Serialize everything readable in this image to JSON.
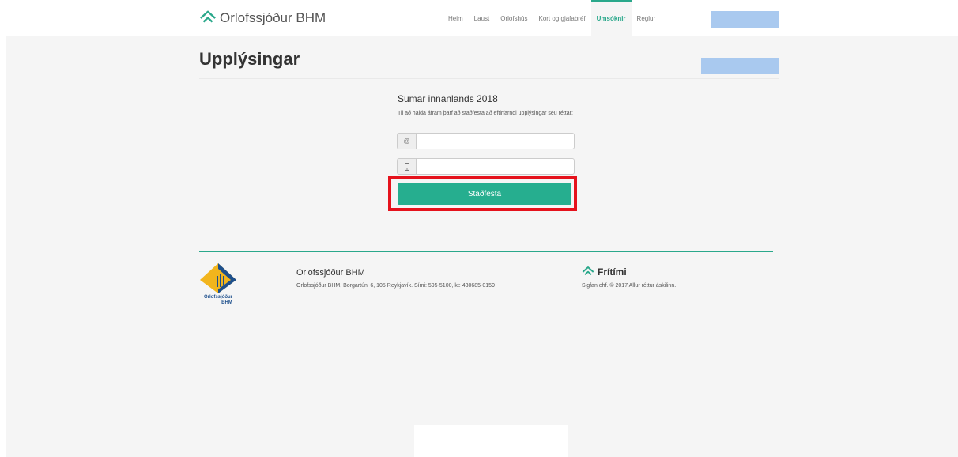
{
  "header": {
    "brand": "Orlofssjóður BHM",
    "nav": [
      "Heim",
      "Laust",
      "Orlofshús",
      "Kort og gjafabréf",
      "Umsóknir",
      "Reglur"
    ],
    "active_nav": "Umsóknir"
  },
  "page": {
    "title": "Upplýsingar"
  },
  "form": {
    "heading": "Sumar innanlands 2018",
    "help_text": "Til að halda áfram þarf að staðfesta að eftirfarndi upplýsingar séu réttar:",
    "email_addon": "@",
    "phone_addon": "☐",
    "email_value": "",
    "phone_value": "",
    "submit_label": "Staðfesta"
  },
  "footer": {
    "org_name": "Orlofssjóður BHM",
    "org_address": "Orlofssjóður BHM, Borgartúni 6, 105 Reykjavík.  Sími: 595-5100, kt: 430685-0159",
    "logo_text_line1": "Orlofssjóður",
    "logo_text_line2": "BHM",
    "partner_name": "Frítími",
    "partner_copyright": "Sigfan ehf. © 2017 Allur réttur áskilinn."
  },
  "colors": {
    "accent": "#26ae8f",
    "highlight": "#e5121c",
    "redacted": "#a9c9ef"
  },
  "icons": {
    "brand": "home-roof-icon",
    "email": "at-icon",
    "phone": "mobile-phone-icon",
    "partner": "home-roof-icon"
  }
}
